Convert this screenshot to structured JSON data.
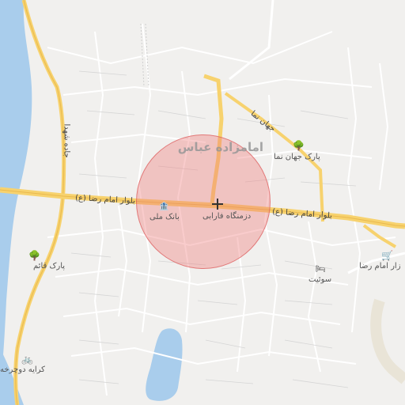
{
  "map": {
    "district": "امامزاده عباس",
    "roads": {
      "boulevard_west": "بلوار امام رضا (ع)",
      "boulevard_east": "بلوار امام رضا (ع)",
      "shohada_road": "جاده شهدا",
      "jahan_nama_street": "جهان نما"
    },
    "places": {
      "park_jahan_nama": "پارک جهان نما",
      "bank_melli": "بانک ملی",
      "farabi_university": "دزمنگاه فارابی",
      "park_ghaem": "پارک قائم",
      "bazaar_imam_reza": "زار امام رضا",
      "suite": "سوئیت",
      "bike_rental": "کرایه دوچرخه"
    },
    "icons": {
      "park_jahan_nama": "tree-icon",
      "park_ghaem": "tree-icon",
      "bank_melli": "bank-icon",
      "bazaar": "shopping-cart-icon",
      "suite": "bed-icon",
      "bike_rental": "bicycle-icon",
      "marker": "crosshair-icon"
    },
    "colors": {
      "background": "#f1f0ee",
      "river": "#a9cdec",
      "major_road": "#f7d26e",
      "minor_road": "#ffffff",
      "highlight_circle": "#f07878"
    }
  }
}
